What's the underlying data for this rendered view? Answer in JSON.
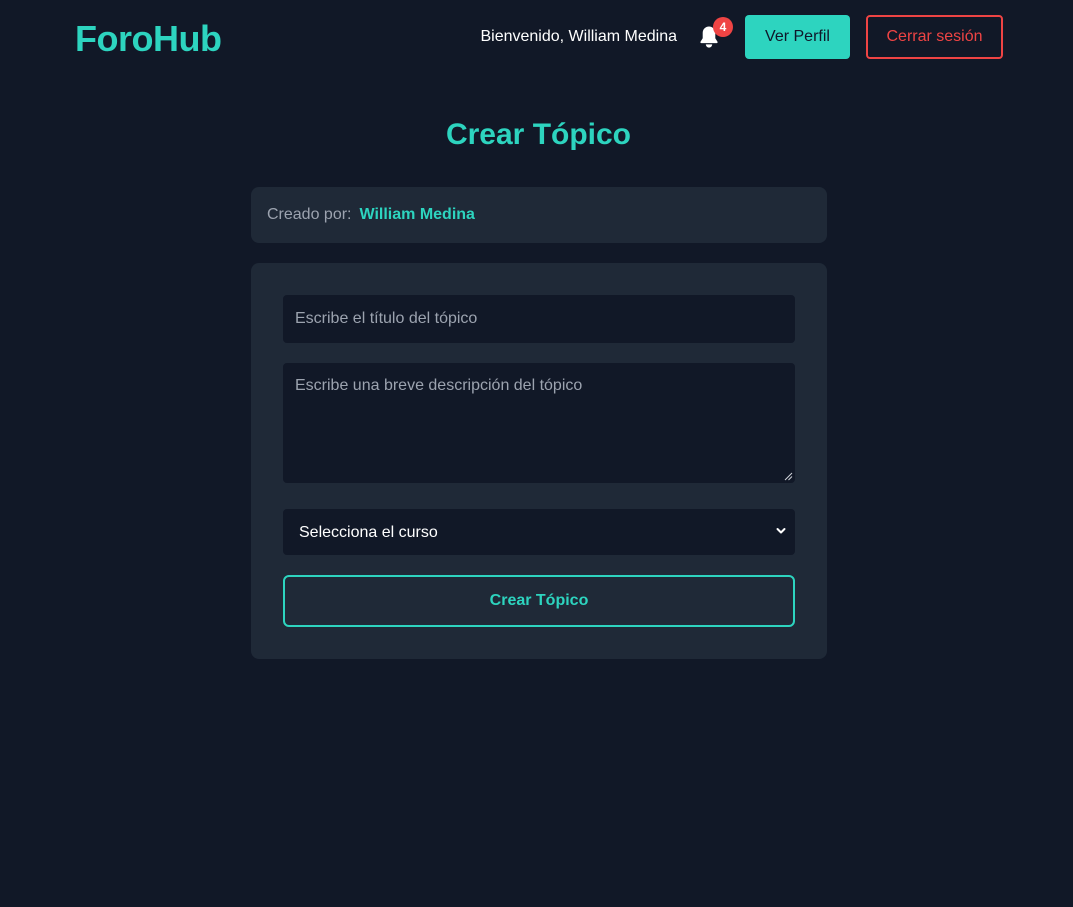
{
  "header": {
    "logo": "ForoHub",
    "welcome_text": "Bienvenido, William Medina",
    "notifications": {
      "icon": "bell-icon",
      "count": "4"
    },
    "profile_button": "Ver Perfil",
    "logout_button": "Cerrar sesión"
  },
  "page": {
    "title": "Crear Tópico"
  },
  "author": {
    "label": "Creado por:",
    "name": "William Medina"
  },
  "form": {
    "title_placeholder": "Escribe el título del tópico",
    "description_placeholder": "Escribe una breve descripción del tópico",
    "course_select": {
      "selected": "Selecciona el curso",
      "icon": "chevron-down-icon"
    },
    "submit_button": "Crear Tópico"
  },
  "colors": {
    "background": "#111827",
    "card": "#1f2937",
    "accent": "#2dd4bf",
    "danger": "#ef4444"
  }
}
